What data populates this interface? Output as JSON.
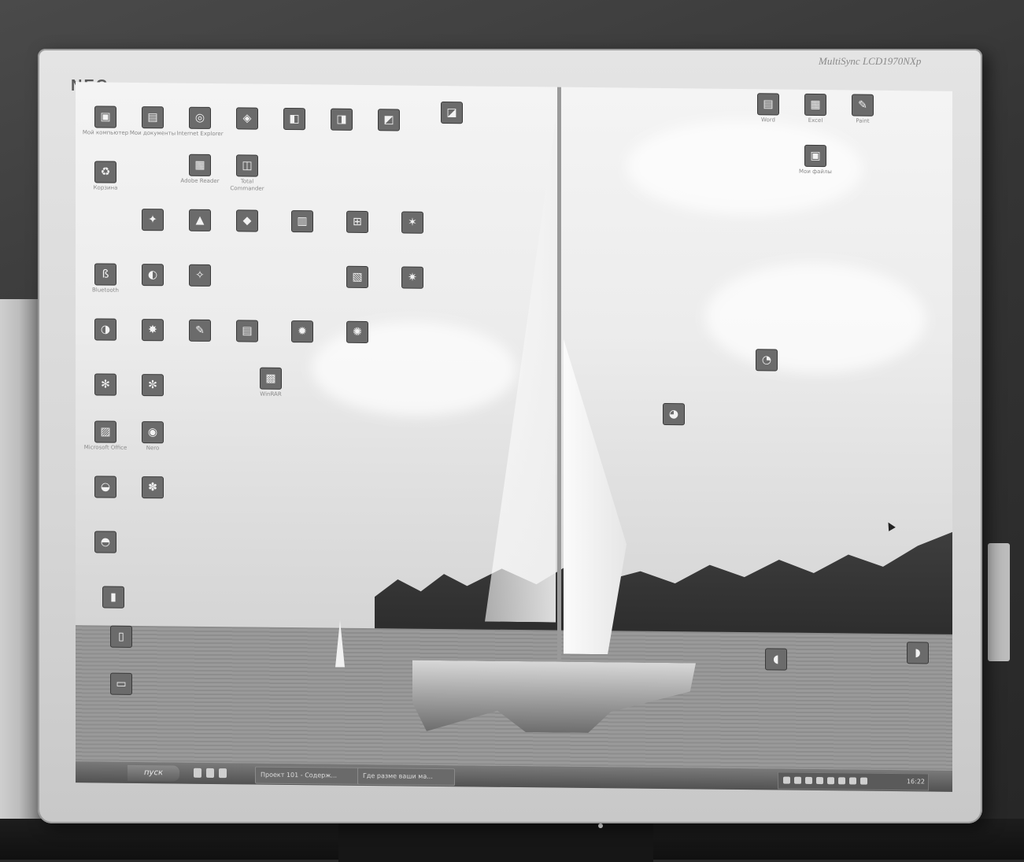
{
  "monitor": {
    "brand": "NEC",
    "model": "MultiSync LCD1970NXp"
  },
  "desktop_icons_left": [
    {
      "label": "Мой компьютер",
      "icon": "computer-icon"
    },
    {
      "label": "Мои документы",
      "icon": "folder-icon"
    },
    {
      "label": "Internet Explorer",
      "icon": "browser-icon"
    },
    {
      "label": "Корзина",
      "icon": "recycle-bin-icon"
    },
    {
      "label": "Bluetooth",
      "icon": "bluetooth-icon"
    },
    {
      "label": "Adobe Reader",
      "icon": "pdf-icon"
    },
    {
      "label": "Total Commander",
      "icon": "app-icon"
    },
    {
      "label": "Microsoft Office",
      "icon": "office-icon"
    },
    {
      "label": "Nero",
      "icon": "disc-icon"
    },
    {
      "label": "WinRAR",
      "icon": "archive-icon"
    }
  ],
  "desktop_icons_right": [
    {
      "label": "Word",
      "icon": "document-icon"
    },
    {
      "label": "Excel",
      "icon": "spreadsheet-icon"
    },
    {
      "label": "Paint",
      "icon": "paint-icon"
    },
    {
      "label": "Мои файлы",
      "icon": "folder-icon"
    }
  ],
  "taskbar": {
    "start_label": "пуск",
    "task1": "Проект 101 - Содерж...",
    "task2": "Где разме ваши ма...",
    "clock": "16:22"
  }
}
